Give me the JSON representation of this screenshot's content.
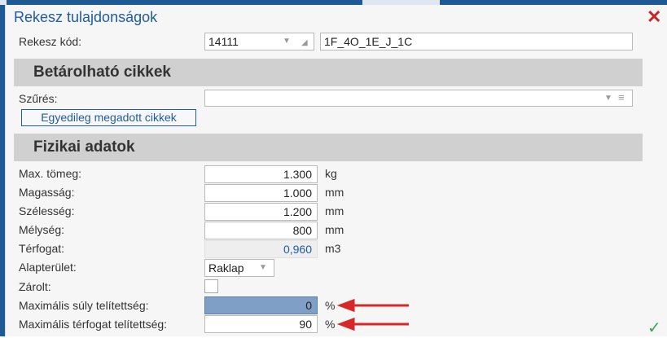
{
  "dialog": {
    "title": "Rekesz tulajdonságok"
  },
  "rekesz_kod": {
    "label": "Rekesz kód:",
    "code": "14111",
    "name": "1F_4O_1E_J_1C"
  },
  "section_betarolhato": {
    "title": "Betárolható cikkek"
  },
  "szures": {
    "label": "Szűrés:",
    "value": ""
  },
  "egyedileg_button": {
    "label": "Egyedileg megadott cikkek"
  },
  "section_fizikai": {
    "title": "Fizikai adatok"
  },
  "fields": {
    "max_tomeg": {
      "label": "Max. tömeg:",
      "value": "1.300",
      "unit": "kg"
    },
    "magassag": {
      "label": "Magasság:",
      "value": "1.000",
      "unit": "mm"
    },
    "szelesseg": {
      "label": "Szélesség:",
      "value": "1.200",
      "unit": "mm"
    },
    "melyseg": {
      "label": "Mélység:",
      "value": "800",
      "unit": "mm"
    },
    "terfogat": {
      "label": "Térfogat:",
      "value": "0,960",
      "unit": "m3"
    },
    "alapterulet": {
      "label": "Alapterület:",
      "value": "Raklap"
    },
    "zarolt": {
      "label": "Zárolt:",
      "checked": false
    },
    "max_suly_telitettseg": {
      "label": "Maximális súly telítettség:",
      "value": "0",
      "unit": "%"
    },
    "max_terfogat_telitettseg": {
      "label": "Maximális térfogat telítettség:",
      "value": "90",
      "unit": "%"
    }
  },
  "colors": {
    "accent": "#1f5ba5",
    "annotation_arrow": "#d62828",
    "close": "#c62828",
    "ok": "#3aa55a"
  },
  "icons": {
    "close": "close-icon",
    "ok": "checkmark-icon"
  }
}
